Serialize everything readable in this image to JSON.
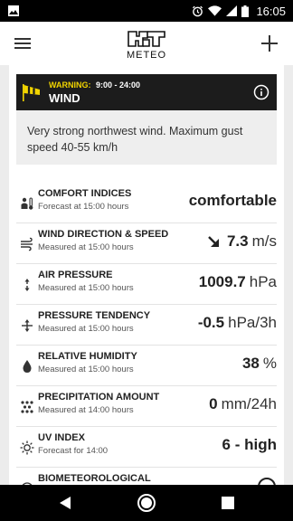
{
  "status_bar": {
    "time": "16:05",
    "icons": [
      "image-icon",
      "alarm-icon",
      "wifi-icon",
      "signal-icon",
      "battery-icon"
    ]
  },
  "app_bar": {
    "logo_text": "METEO",
    "menu_icon": "hamburger-menu-icon",
    "add_icon": "plus-icon"
  },
  "warning": {
    "label": "WARNING:",
    "time": "9:00 - 24:00",
    "title": "WIND",
    "description": "Very strong northwest wind.  Maximum gust speed 40-55 km/h",
    "accent_color": "#f2d500",
    "header_bg": "#1c1c1c"
  },
  "rows": [
    {
      "title": "COMFORT INDICES",
      "sub": "Forecast at 15:00 hours",
      "value": "comfortable",
      "unit": "",
      "icon": "comfort-icon"
    },
    {
      "title": "WIND DIRECTION & SPEED",
      "sub": "Measured at 15:00 hours",
      "value": "7.3",
      "unit": "m/s",
      "icon": "wind-icon",
      "direction_icon": "arrow-southeast-icon"
    },
    {
      "title": "AIR PRESSURE",
      "sub": "Measured at 15:00 hours",
      "value": "1009.7",
      "unit": "hPa",
      "icon": "pressure-icon"
    },
    {
      "title": "PRESSURE TENDENCY",
      "sub": "Measured at 15:00 hours",
      "value": "-0.5",
      "unit": "hPa/3h",
      "icon": "pressure-tendency-icon"
    },
    {
      "title": "RELATIVE HUMIDITY",
      "sub": "Measured at 15:00 hours",
      "value": "38",
      "unit": "%",
      "icon": "humidity-drop-icon"
    },
    {
      "title": "PRECIPITATION AMOUNT",
      "sub": "Measured at 14:00 hours",
      "value": "0",
      "unit": "mm/24h",
      "icon": "precipitation-icon"
    },
    {
      "title": "UV INDEX",
      "sub": "Forecast for 14:00",
      "value": "6 - high",
      "unit": "",
      "icon": "sun-icon"
    },
    {
      "title": "BIOMETEOROLOGICAL",
      "sub": "",
      "value": "",
      "unit": "",
      "icon": "bio-icon"
    }
  ],
  "nav_bar": {
    "icons": [
      "back-icon",
      "home-icon",
      "recent-apps-icon"
    ]
  }
}
